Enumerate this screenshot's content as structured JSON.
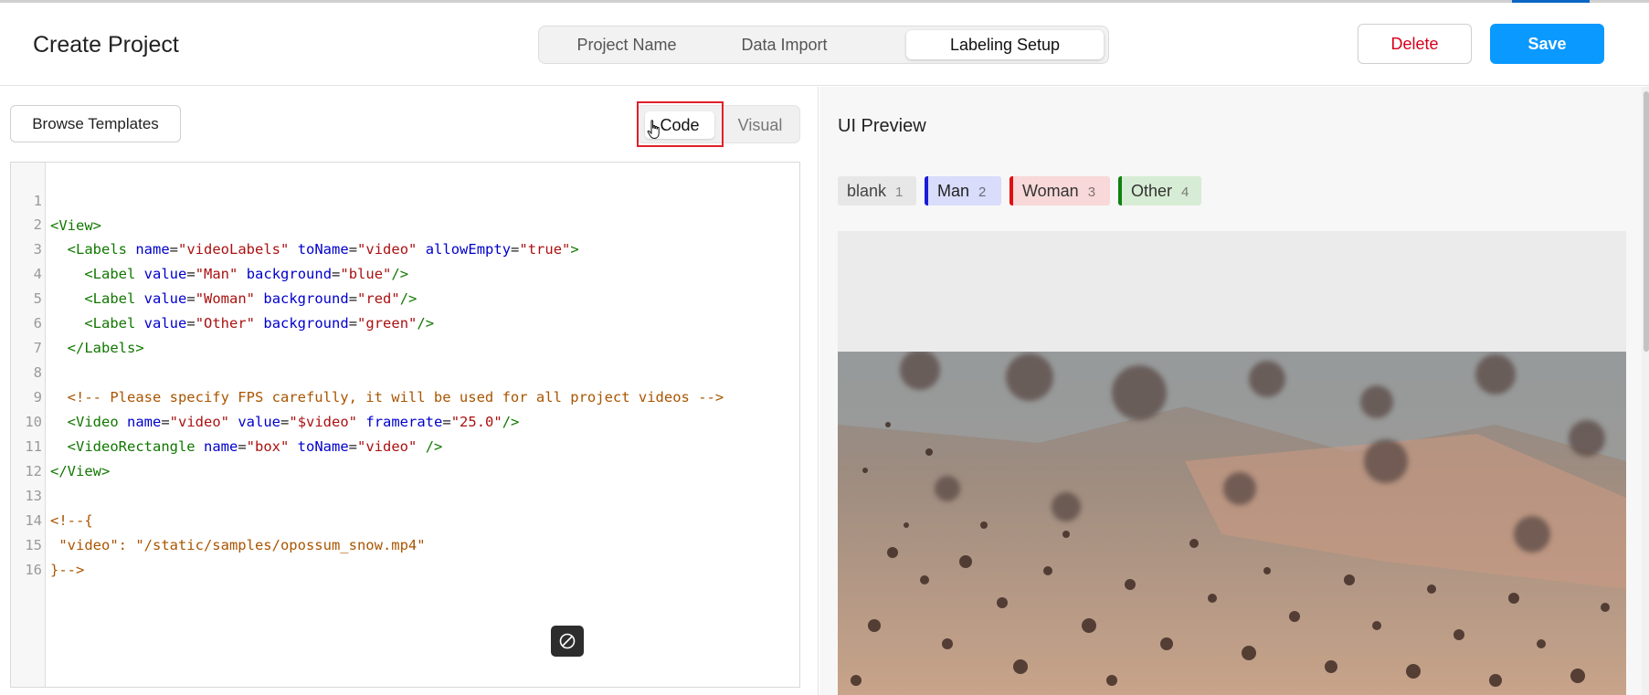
{
  "header": {
    "title": "Create Project",
    "steps": [
      "Project Name",
      "Data Import",
      "Labeling Setup"
    ],
    "active_step": "Labeling Setup",
    "delete_label": "Delete",
    "save_label": "Save"
  },
  "editor_panel": {
    "browse_label": "Browse Templates",
    "view_modes": {
      "code": "Code",
      "visual": "Visual"
    },
    "active_view": "Code",
    "line_numbers": [
      "1",
      "2",
      "3",
      "4",
      "5",
      "6",
      "7",
      "8",
      "9",
      "10",
      "11",
      "12",
      "13",
      "14",
      "15",
      "16"
    ],
    "code_lines": [
      "<View>",
      "  <Labels name=\"videoLabels\" toName=\"video\" allowEmpty=\"true\">",
      "    <Label value=\"Man\" background=\"blue\"/>",
      "    <Label value=\"Woman\" background=\"red\"/>",
      "    <Label value=\"Other\" background=\"green\"/>",
      "  </Labels>",
      "",
      "  <!-- Please specify FPS carefully, it will be used for all project videos -->",
      "  <Video name=\"video\" value=\"$video\" framerate=\"25.0\"/>",
      "  <VideoRectangle name=\"box\" toName=\"video\" />",
      "</View>",
      "",
      "<!--{",
      " \"video\": \"/static/samples/opossum_snow.mp4\"",
      "}-->",
      ""
    ]
  },
  "preview_panel": {
    "title": "UI Preview",
    "labels": [
      {
        "text": "blank",
        "hotkey": "1",
        "color": "#e7e7e7"
      },
      {
        "text": "Man",
        "hotkey": "2",
        "color": "#1b1bd8"
      },
      {
        "text": "Woman",
        "hotkey": "3",
        "color": "#e01010"
      },
      {
        "text": "Other",
        "hotkey": "4",
        "color": "#108010"
      }
    ]
  },
  "colors": {
    "accent": "#0a99ff",
    "danger": "#d6001c",
    "highlight": "#e0202a"
  }
}
